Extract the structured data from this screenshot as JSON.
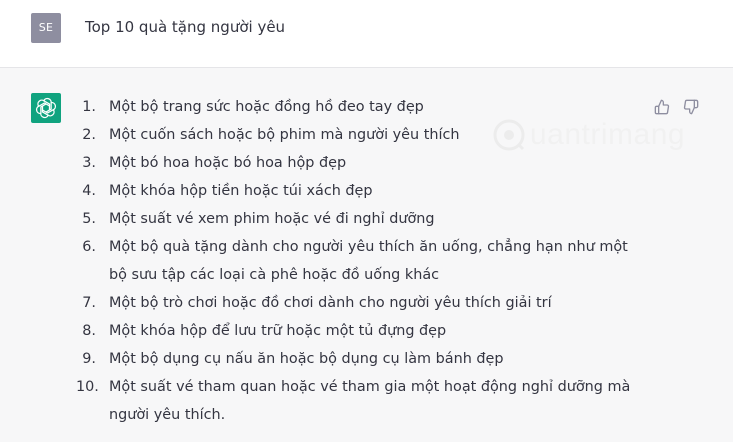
{
  "user": {
    "avatar_initials": "SE",
    "message": "Top 10 quà tặng người yêu"
  },
  "watermark": {
    "text": "uantrimang"
  },
  "assistant": {
    "items": [
      {
        "num": "1.",
        "text": "Một bộ trang sức hoặc đồng hồ đeo tay đẹp"
      },
      {
        "num": "2.",
        "text": "Một cuốn sách hoặc bộ phim mà người yêu thích"
      },
      {
        "num": "3.",
        "text": "Một bó hoa hoặc bó hoa hộp đẹp"
      },
      {
        "num": "4.",
        "text": "Một khóa hộp tiền hoặc túi xách đẹp"
      },
      {
        "num": "5.",
        "text": "Một suất vé xem phim hoặc vé đi nghỉ dưỡng"
      },
      {
        "num": "6.",
        "text": "Một bộ quà tặng dành cho người yêu thích ăn uống, chẳng hạn như một bộ sưu tập các loại cà phê hoặc đồ uống khác"
      },
      {
        "num": "7.",
        "text": "Một bộ trò chơi hoặc đồ chơi dành cho người yêu thích giải trí"
      },
      {
        "num": "8.",
        "text": "Một khóa hộp để lưu trữ hoặc một tủ đựng đẹp"
      },
      {
        "num": "9.",
        "text": "Một bộ dụng cụ nấu ăn hoặc bộ dụng cụ làm bánh đẹp"
      },
      {
        "num": "10.",
        "text": "Một suất vé tham quan hoặc vé tham gia một hoạt động nghỉ dưỡng mà người yêu thích."
      }
    ]
  },
  "icons": {
    "bot_avatar": "openai-logo-icon",
    "thumbs_up": "thumbs-up-icon",
    "thumbs_down": "thumbs-down-icon"
  },
  "colors": {
    "bot_avatar_bg": "#10a37f",
    "user_avatar_bg": "#8e8ea0",
    "assistant_bg": "#f7f7f8",
    "text": "#343541"
  }
}
